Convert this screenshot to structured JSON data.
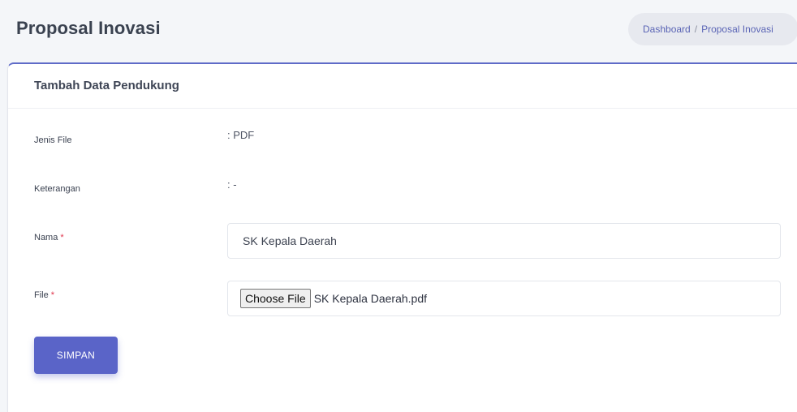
{
  "header": {
    "title": "Proposal Inovasi",
    "breadcrumb": {
      "home": "Dashboard",
      "separator": "/",
      "current": "Proposal Inovasi"
    }
  },
  "card": {
    "title": "Tambah Data Pendukung",
    "fields": {
      "jenis_file": {
        "label": "Jenis File",
        "value": ": PDF"
      },
      "keterangan": {
        "label": "Keterangan",
        "value": ": -"
      },
      "nama": {
        "label": "Nama",
        "required_mark": "*",
        "value": "SK Kepala Daerah"
      },
      "file": {
        "label": "File",
        "required_mark": "*",
        "button_label": "Choose File",
        "file_name": "SK Kepala Daerah.pdf"
      }
    },
    "submit_label": "SIMPAN"
  },
  "colors": {
    "accent": "#5a64c8",
    "required": "#e0334a",
    "breadcrumb_bg": "#e7e9ef",
    "page_bg": "#f4f6f9"
  }
}
